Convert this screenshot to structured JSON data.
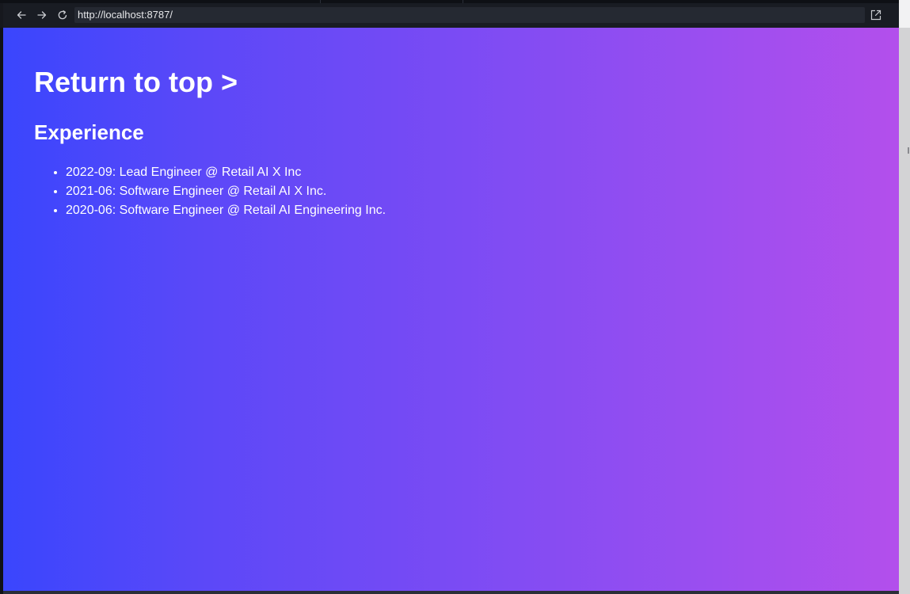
{
  "browser": {
    "url": "http://localhost:8787/",
    "icons": {
      "back": "arrow-left-icon",
      "forward": "arrow-right-icon",
      "reload": "reload-icon",
      "open_external": "open-external-icon"
    }
  },
  "page": {
    "top_link": "Return to top >",
    "section_title": "Experience",
    "experience": [
      "2022-09: Lead Engineer @ Retail AI X Inc",
      "2021-06: Software Engineer @ Retail AI X Inc.",
      "2020-06: Software Engineer @ Retail AI Engineering Inc."
    ],
    "colors": {
      "gradient_start": "#3a46fd",
      "gradient_end": "#b34fec",
      "text": "#ffffff"
    }
  }
}
